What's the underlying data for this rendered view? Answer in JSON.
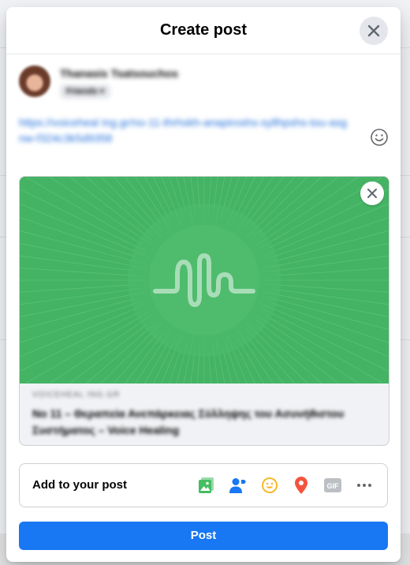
{
  "dialog": {
    "title": "Create post"
  },
  "author": {
    "name": "Thanasis Tsatsouchos",
    "audience": "Friends"
  },
  "composer": {
    "text": "https://voiceheal ing.gr/no-11-thrhskh-anapiroshs-syllhpshs-tou-asgnw-f324c3k5d9358"
  },
  "link_preview": {
    "domain": "voiceheal ing.gr",
    "title": "No 11 – Θεραπεία Ανεπάρκειας Σύλληψης του Ασυνήθιστου Συστήματος – Voice Healing",
    "image_color": "#45b565"
  },
  "add_to_post": {
    "label": "Add to your post",
    "tools": [
      {
        "icon": "photo-video-icon",
        "color": "#45bd62"
      },
      {
        "icon": "tag-people-icon",
        "color": "#1877f2"
      },
      {
        "icon": "feeling-activity-icon",
        "color": "#f7b928"
      },
      {
        "icon": "check-in-icon",
        "color": "#f5533d"
      },
      {
        "icon": "gif-icon",
        "color": "#bcc0c4"
      },
      {
        "icon": "more-icon",
        "color": "#65676b"
      }
    ]
  },
  "actions": {
    "post_label": "Post"
  }
}
